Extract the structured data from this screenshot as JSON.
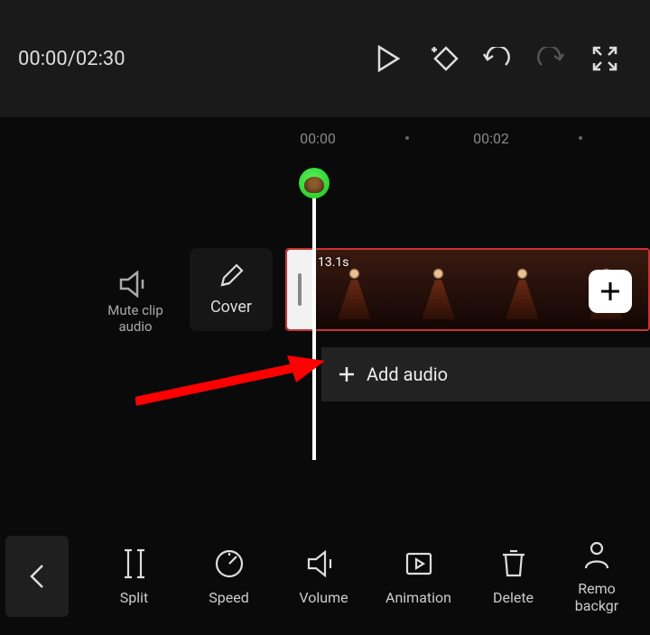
{
  "top": {
    "time_position": "00:00",
    "time_total": "02:30",
    "time_display": "00:00/02:30"
  },
  "ruler": {
    "t0": "00:00",
    "t1": "00:02"
  },
  "side": {
    "mute_line1": "Mute clip",
    "mute_line2": "audio",
    "cover": "Cover"
  },
  "clip": {
    "duration": "13.1s"
  },
  "audio": {
    "add_label": "Add audio"
  },
  "tools": {
    "split": "Split",
    "speed": "Speed",
    "volume": "Volume",
    "animation": "Animation",
    "delete": "Delete",
    "remove_bg_1": "Remo",
    "remove_bg_2": "backgr"
  }
}
